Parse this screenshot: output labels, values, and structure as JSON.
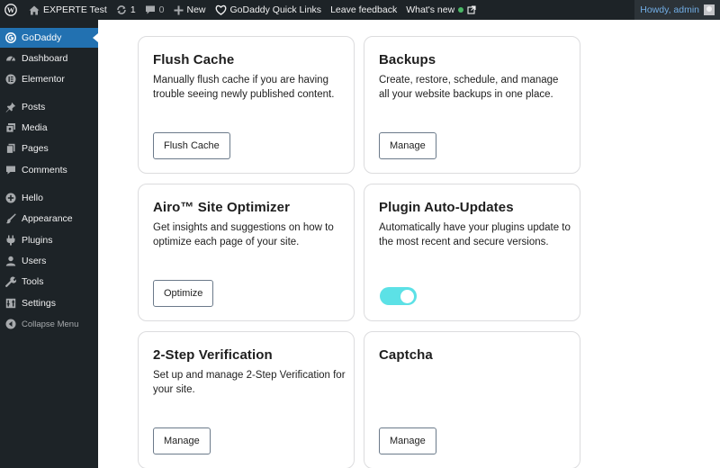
{
  "adminbar": {
    "site_name": "EXPERTE Test",
    "updates_count": "1",
    "comments_count": "0",
    "new_label": "New",
    "quick_links_label": "GoDaddy Quick Links",
    "feedback_label": "Leave feedback",
    "whats_new_label": "What's new",
    "howdy_label": "Howdy, admin"
  },
  "sidebar": {
    "items": [
      {
        "label": "GoDaddy",
        "icon": "godaddy-icon",
        "active": true
      },
      {
        "label": "Dashboard",
        "icon": "dashboard-icon"
      },
      {
        "label": "Elementor",
        "icon": "elementor-icon"
      },
      {
        "label": "Posts",
        "icon": "pin-icon"
      },
      {
        "label": "Media",
        "icon": "media-icon"
      },
      {
        "label": "Pages",
        "icon": "pages-icon"
      },
      {
        "label": "Comments",
        "icon": "comment-icon"
      },
      {
        "label": "Hello",
        "icon": "plus-circle-icon"
      },
      {
        "label": "Appearance",
        "icon": "brush-icon"
      },
      {
        "label": "Plugins",
        "icon": "plug-icon"
      },
      {
        "label": "Users",
        "icon": "user-icon"
      },
      {
        "label": "Tools",
        "icon": "wrench-icon"
      },
      {
        "label": "Settings",
        "icon": "settings-icon"
      },
      {
        "label": "Collapse Menu",
        "icon": "collapse-icon"
      }
    ]
  },
  "cards": {
    "flush_cache": {
      "title": "Flush Cache",
      "desc": "Manually flush cache if you are having trouble seeing newly published content.",
      "button": "Flush Cache"
    },
    "backups": {
      "title": "Backups",
      "desc": "Create, restore, schedule, and manage all your website backups in one place.",
      "button": "Manage"
    },
    "optimizer": {
      "title": "Airo™ Site Optimizer",
      "desc": "Get insights and suggestions on how to optimize each page of your site.",
      "button": "Optimize"
    },
    "auto_updates": {
      "title": "Plugin Auto-Updates",
      "desc": "Automatically have your plugins update to the most recent and secure versions.",
      "toggle_on": true
    },
    "two_step": {
      "title": "2-Step Verification",
      "desc": "Set up and manage 2-Step Verification for your site.",
      "button": "Manage"
    },
    "captcha": {
      "title": "Captcha",
      "button": "Manage"
    }
  },
  "colors": {
    "adminbar_bg": "#1d2327",
    "active_menu": "#2271b1",
    "toggle_on": "#5ce1e6",
    "howdy_text": "#72aee6"
  }
}
